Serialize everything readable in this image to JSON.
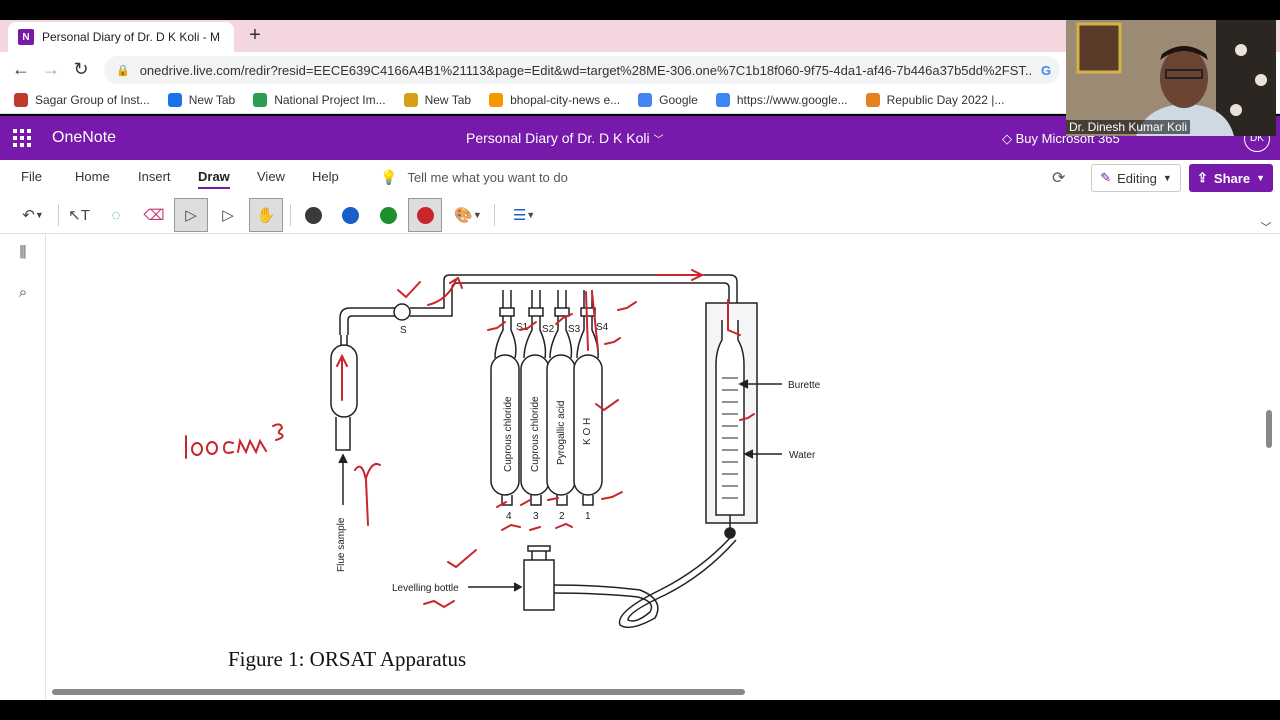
{
  "browser": {
    "tab_title": "Personal Diary of Dr. D K Koli - M",
    "new_tab_symbol": "+",
    "url": "onedrive.live.com/redir?resid=EECE639C4166A4B1%21113&page=Edit&wd=target%28ME-306.one%7C1b18f060-9f75-4da1-af46-7b446a37b5dd%2FST...",
    "bookmarks": [
      {
        "label": "Sagar Group of Inst...",
        "color": "#c0392b"
      },
      {
        "label": "New Tab",
        "color": "#1a73e8"
      },
      {
        "label": "National Project Im...",
        "color": "#2e9d4f"
      },
      {
        "label": "New Tab",
        "color": "#d4a017"
      },
      {
        "label": "bhopal-city-news e...",
        "color": "#f29900"
      },
      {
        "label": "Google",
        "color": "#4285f4"
      },
      {
        "label": "https://www.google...",
        "color": "#4285f4"
      },
      {
        "label": "Republic Day 2022 |...",
        "color": "#e67e22"
      }
    ]
  },
  "onenote": {
    "app_name": "OneNote",
    "doc_title": "Personal Diary of Dr. D K Koli",
    "buy_label": "Buy Microsoft 365",
    "avatar_initials": "DK",
    "menus": [
      "File",
      "Home",
      "Insert",
      "Draw",
      "View",
      "Help"
    ],
    "active_menu": "Draw",
    "tell_me": "Tell me what you want to do",
    "editing_label": "Editing",
    "share_label": "Share",
    "pen_colors": [
      "#3a3a3a",
      "#1a5fc8",
      "#1e8f2e",
      "#c8262b"
    ]
  },
  "webcam": {
    "name_label": "Dr. Dinesh Kumar Koli"
  },
  "diagram": {
    "labels": {
      "s_valve": "S",
      "s1": "S1",
      "s2": "S2",
      "s3": "S3",
      "s4": "S4",
      "burette": "Burette",
      "water": "Water",
      "flue_sample": "Flue sample",
      "levelling_bottle": "Levelling bottle",
      "bulb1": "Cuprous chloride",
      "bulb2": "Cuprous chloride",
      "bulb3": "Pyrogallic acid",
      "bulb4": "K O H",
      "n4": "4",
      "n3": "3",
      "n2": "2",
      "n1": "1"
    },
    "handwritten_note": "100cm³",
    "caption": "Figure 1: ORSAT Apparatus"
  }
}
